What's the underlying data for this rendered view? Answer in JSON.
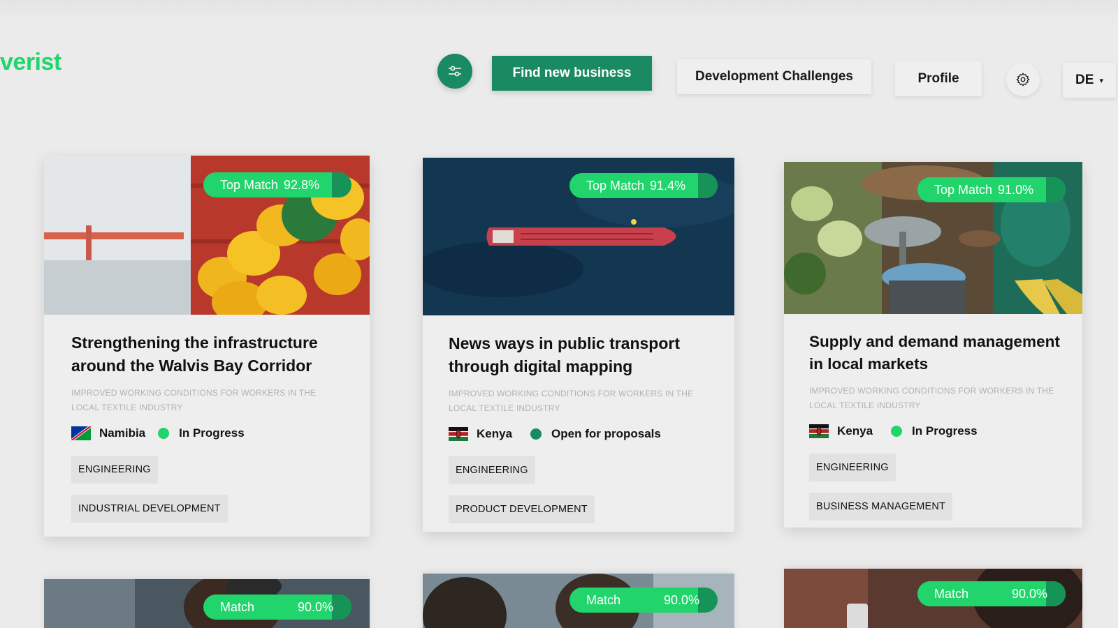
{
  "brand": {
    "logo_text": "verist"
  },
  "nav": {
    "filter_icon": "sliders-icon",
    "find_label": "Find new business",
    "dev_label": "Development Challenges",
    "profile_label": "Profile",
    "settings_icon": "gear-icon",
    "lang_label": "DE",
    "lang_caret": "▾"
  },
  "colors": {
    "brand_green": "#21d46b",
    "dark_green": "#1a8a62",
    "status_in_progress": "#21d46b",
    "status_open": "#1a8a62"
  },
  "cards": [
    {
      "match_label": "Top Match",
      "match_value": "92.8%",
      "title": "Strengthening the infrastructure around the Walvis Bay Corridor",
      "subtitle": "IMPROVED WORKING CONDITIONS FOR WORKERS IN THE LOCAL TEXTILE INDUSTRY",
      "country": "Namibia",
      "country_flag_icon": "namibia-flag-icon",
      "status": "In Progress",
      "tags": [
        "ENGINEERING",
        "INDUSTRIAL DEVELOPMENT"
      ]
    },
    {
      "match_label": "Top Match",
      "match_value": "91.4%",
      "title": "News ways in public transport through digital mapping",
      "subtitle": "IMPROVED WORKING CONDITIONS FOR WORKERS IN THE LOCAL TEXTILE INDUSTRY",
      "country": "Kenya",
      "country_flag_icon": "kenya-flag-icon",
      "status": "Open for proposals",
      "tags": [
        "ENGINEERING",
        "PRODUCT DEVELOPMENT"
      ]
    },
    {
      "match_label": "Top Match",
      "match_value": "91.0%",
      "title": "Supply and demand management in local markets",
      "subtitle": "IMPROVED WORKING CONDITIONS FOR WORKERS IN THE LOCAL TEXTILE INDUSTRY",
      "country": "Kenya",
      "country_flag_icon": "kenya-flag-icon",
      "status": "In Progress",
      "tags": [
        "ENGINEERING",
        "BUSINESS MANAGEMENT"
      ]
    }
  ],
  "bottom_cards": [
    {
      "match_label": "Match",
      "match_value": "90.0%"
    },
    {
      "match_label": "Match",
      "match_value": "90.0%"
    },
    {
      "match_label": "Match",
      "match_value": "90.0%"
    }
  ]
}
